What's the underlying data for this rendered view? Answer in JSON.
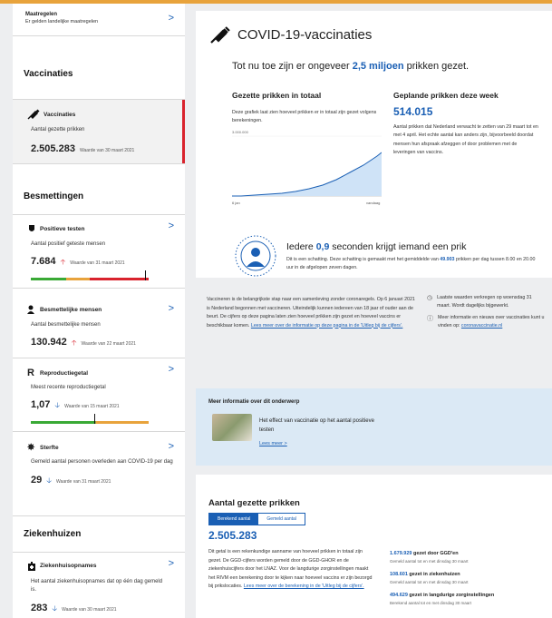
{
  "sidebar": {
    "maatregelen": {
      "title": "Maatregelen",
      "sub": "Er gelden landelijke maatregelen"
    },
    "vaccinaties_heading": "Vaccinaties",
    "vaccinaties": {
      "title": "Vaccinaties",
      "sub": "Aantal gezette prikken",
      "value": "2.505.283",
      "date": "Waarde van 30 maart 2021"
    },
    "besmettingen_heading": "Besmettingen",
    "positieve": {
      "title": "Positieve testen",
      "sub": "Aantal positief geteste mensen",
      "value": "7.684",
      "date": "Waarde van 31 maart 2021"
    },
    "besmettelijk": {
      "title": "Besmettelijke mensen",
      "sub": "Aantal besmettelijke mensen",
      "value": "130.942",
      "date": "Waarde van 22 maart 2021"
    },
    "reproductie": {
      "title": "Reproductiegetal",
      "sub": "Meest recente reproductiegetal",
      "value": "1,07",
      "date": "Waarde van 15 maart 2021",
      "letter": "R"
    },
    "sterfte": {
      "title": "Sterfte",
      "sub": "Gemeld aantal personen overleden aan COVID-19 per dag",
      "value": "29",
      "date": "Waarde van 31 maart 2021"
    },
    "ziekenhuizen_heading": "Ziekenhuizen",
    "ziekenhuis": {
      "title": "Ziekenhuisopnames",
      "sub": "Het aantal ziekenhuisopnames dat op één dag gemeld is.",
      "value": "283",
      "date": "Waarde van 30 maart 2021"
    },
    "chevron": ">"
  },
  "main": {
    "title": "COVID-19-vaccinaties",
    "lead_pre": "Tot nu toe zijn er ongeveer ",
    "lead_highlight": "2,5 miljoen",
    "lead_post": " prikken gezet.",
    "total_heading": "Gezette prikken in totaal",
    "total_desc": "Deze grafiek laat zien hoeveel prikken er in totaal zijn gezet volgens berekeningen.",
    "chart_ymax": "3.000.000",
    "chart_x_start": "6 jan",
    "chart_x_end": "vandaag",
    "planned_heading": "Geplande prikken deze week",
    "planned_value": "514.015",
    "planned_desc": "Aantal prikken dat Nederland verwacht te zetten van 29 maart tot en met 4 april. Het echte aantal kan anders zijn, bijvoorbeeld doordat mensen hun afspraak afzeggen of door problemen met de leveringen van vaccins.",
    "every_pre": "Iedere ",
    "every_highlight": "0,9",
    "every_post": " seconden krijgt iemand een prik",
    "every_desc_pre": "Dit is een schatting. Deze schatting is gemaakt met het gemiddelde van ",
    "every_desc_highlight": "49.903",
    "every_desc_post": " prikken per dag tussen 8.00 en 20.00 uur in de afgelopen zeven dagen."
  },
  "intro": {
    "text": "Vaccineren is de belangrijkste stap naar een samenleving zonder coronaregels. Op 6 januari 2021 is Nederland begonnen met vaccineren. Uiteindelijk kunnen iedereen van 18 jaar of ouder aan de beurt. De cijfers op deze pagina laten zien hoeveel prikken zijn gezet en hoeveel vaccins er beschikbaar komen. ",
    "link": "Lees meer over de informatie op deze pagina in de 'Uitleg bij de cijfers'.",
    "meta1": "Laatste waarden verkregen op woensdag 31 maart. Wordt dagelijks bijgewerkt.",
    "meta2_pre": "Meer informatie en nieuws over vaccinaties kunt u vinden op: ",
    "meta2_link": "coronavaccinatie.nl"
  },
  "more": {
    "heading": "Meer informatie over dit onderwerp",
    "article": "Het effect van vaccinatie op het aantal positieve testen",
    "read_more": "Lees meer >"
  },
  "aantal": {
    "heading": "Aantal gezette prikken",
    "tabs": [
      "Berekend aantal",
      "Gemeld aantal"
    ],
    "value": "2.505.283",
    "text": "Dit getal is een rekenkundige aanname van hoeveel prikken in totaal zijn gezet. De GGD-cijfers worden gemeld door de GGD-GHOR en de ziekenhuiscijfers door het LNAZ. Voor de langdurige zorginstellingen maakt het RIVM een berekening door te kijken naar hoeveel vaccins er zijn bezorgd bij prikslocaties. ",
    "link": "Lees meer over de berekening in de 'Uitleg bij de cijfers'.",
    "stats": [
      {
        "value": "1.679.929",
        "label": " gezet door GGD'en",
        "sub": "Gemeld aantal tot en met dinsdag 30 maart"
      },
      {
        "value": "108.601",
        "label": " gezet in ziekenhuizen",
        "sub": "Gemeld aantal tot en met dinsdag 30 maart"
      },
      {
        "value": "494.629",
        "label": " gezet in langdurige zorginstellingen",
        "sub": "Berekend aantal tot en met dinsdag 30 maart"
      }
    ]
  },
  "colors": {
    "accent": "#1a5fb4",
    "red": "#d9232d",
    "green": "#39a935",
    "orange": "#e8a33c"
  }
}
